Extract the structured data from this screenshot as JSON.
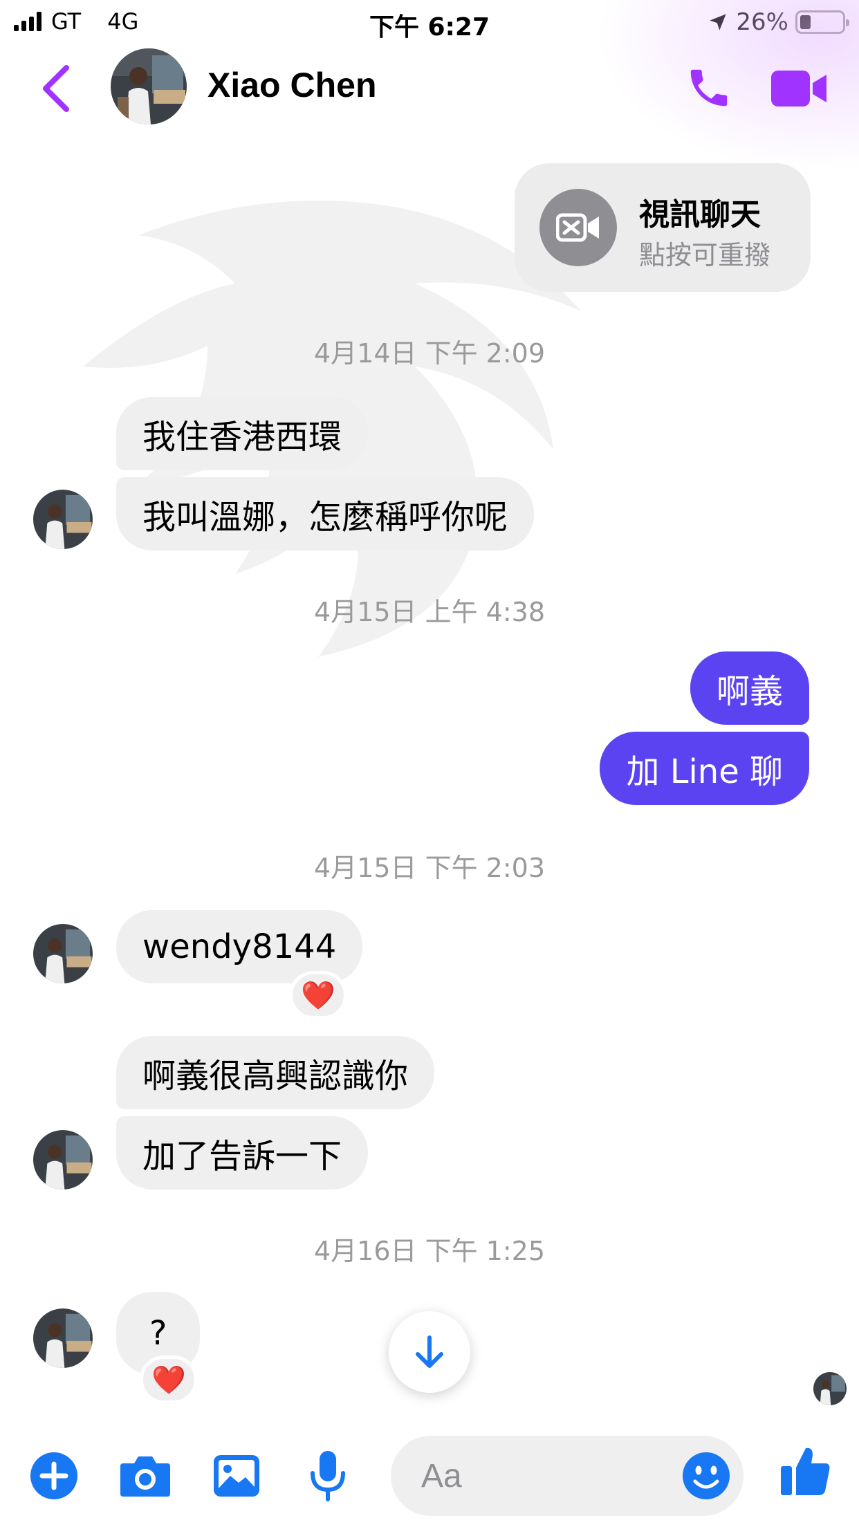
{
  "status_bar": {
    "carrier": "GT",
    "network": "4G",
    "time": "下午 6:27",
    "battery": "26%",
    "battery_level": 0.26
  },
  "header": {
    "contact_name": "Xiao Chen",
    "icons": [
      "chevron-left-icon",
      "phone-icon",
      "video-camera-icon"
    ]
  },
  "call_card": {
    "title": "視訊聊天",
    "subtitle": "點按可重撥",
    "icon": "missed-video-icon"
  },
  "conversation": {
    "ts1": "4月14日 下午 2:09",
    "msg1": "我住香港西環",
    "msg2": "我叫溫娜，怎麼稱呼你呢",
    "ts2": "4月15日 上午 4:38",
    "out1": "啊義",
    "out2": "加 Line 聊",
    "ts3": "4月15日 下午 2:03",
    "msg3": "wendy8144",
    "msg3_reaction": "❤️",
    "msg4": "啊義很高興認識你",
    "msg5": "加了告訴一下",
    "ts4": "4月16日 下午 1:25",
    "msg6": "?",
    "msg6_reaction": "❤️"
  },
  "composer": {
    "placeholder": "Aa",
    "icons": [
      "plus-icon",
      "camera-icon",
      "image-icon",
      "microphone-icon",
      "emoji-icon",
      "thumbs-up-icon"
    ]
  },
  "colors": {
    "accent_purple": "#a033ff",
    "outgoing_bubble": "#5b43f2",
    "incoming_bubble": "#efeff0",
    "composer_blue": "#1877f2"
  }
}
